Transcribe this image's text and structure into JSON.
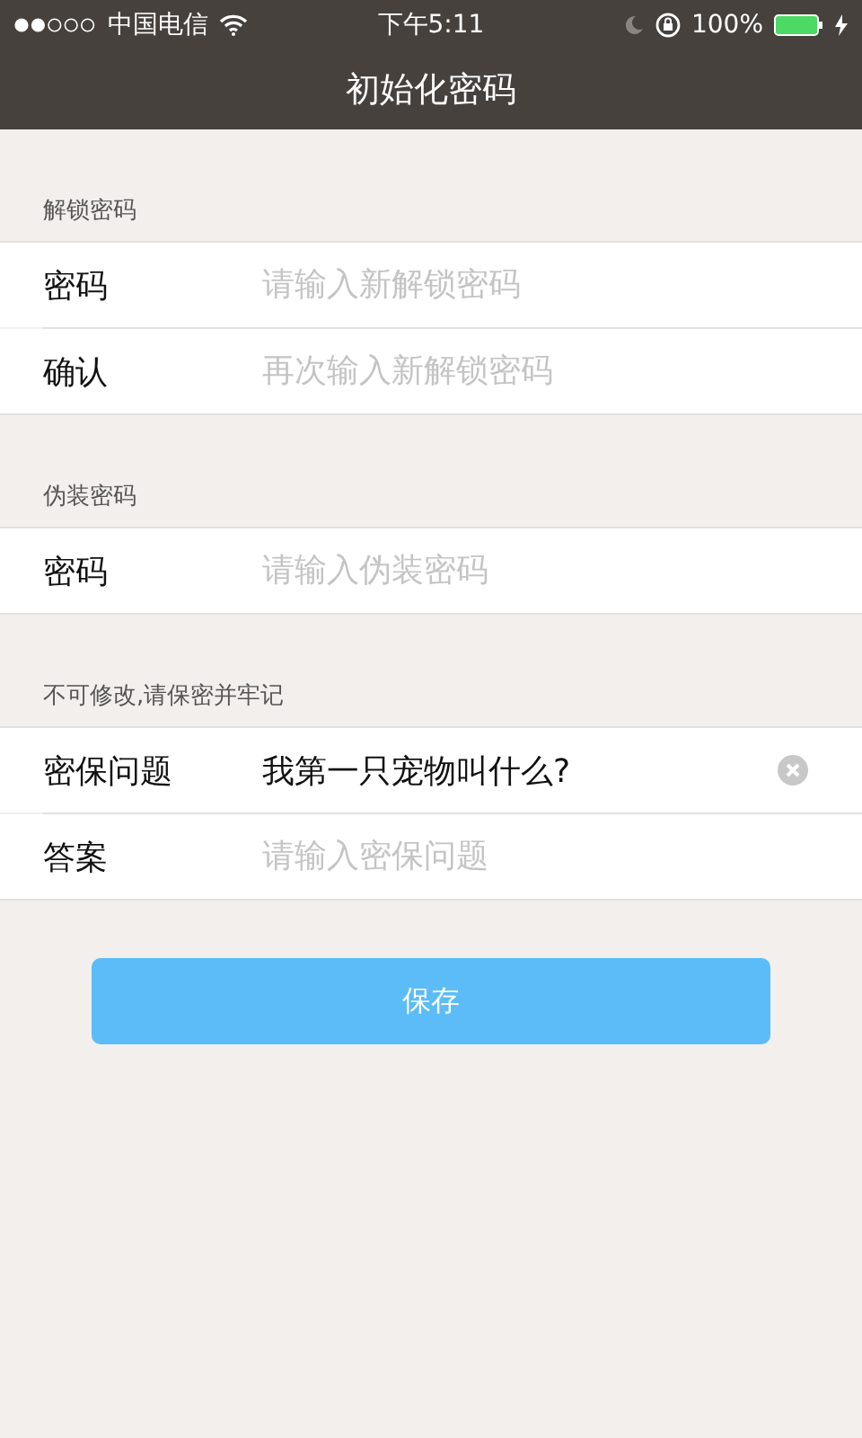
{
  "status_bar": {
    "carrier": "中国电信",
    "time": "下午5:11",
    "battery": "100%"
  },
  "nav_bar": {
    "title": "初始化密码"
  },
  "sections": [
    {
      "header": "解锁密码",
      "rows": [
        {
          "label": "密码",
          "placeholder": "请输入新解锁密码",
          "clear_button": false
        },
        {
          "label": "确认",
          "placeholder": "再次输入新解锁密码",
          "clear_button": false
        }
      ]
    },
    {
      "header": "伪装密码",
      "rows": [
        {
          "label": "密码",
          "placeholder": "请输入伪装密码",
          "clear_button": false
        }
      ]
    },
    {
      "header": "不可修改,请保密并牢记",
      "rows": [
        {
          "label": "密保问题",
          "value": "我第一只宠物叫什么?",
          "clear_button": true
        },
        {
          "label": "答案",
          "placeholder": "请输入密保问题",
          "clear_button": false
        }
      ]
    }
  ],
  "save_button": {
    "label": "保存"
  }
}
